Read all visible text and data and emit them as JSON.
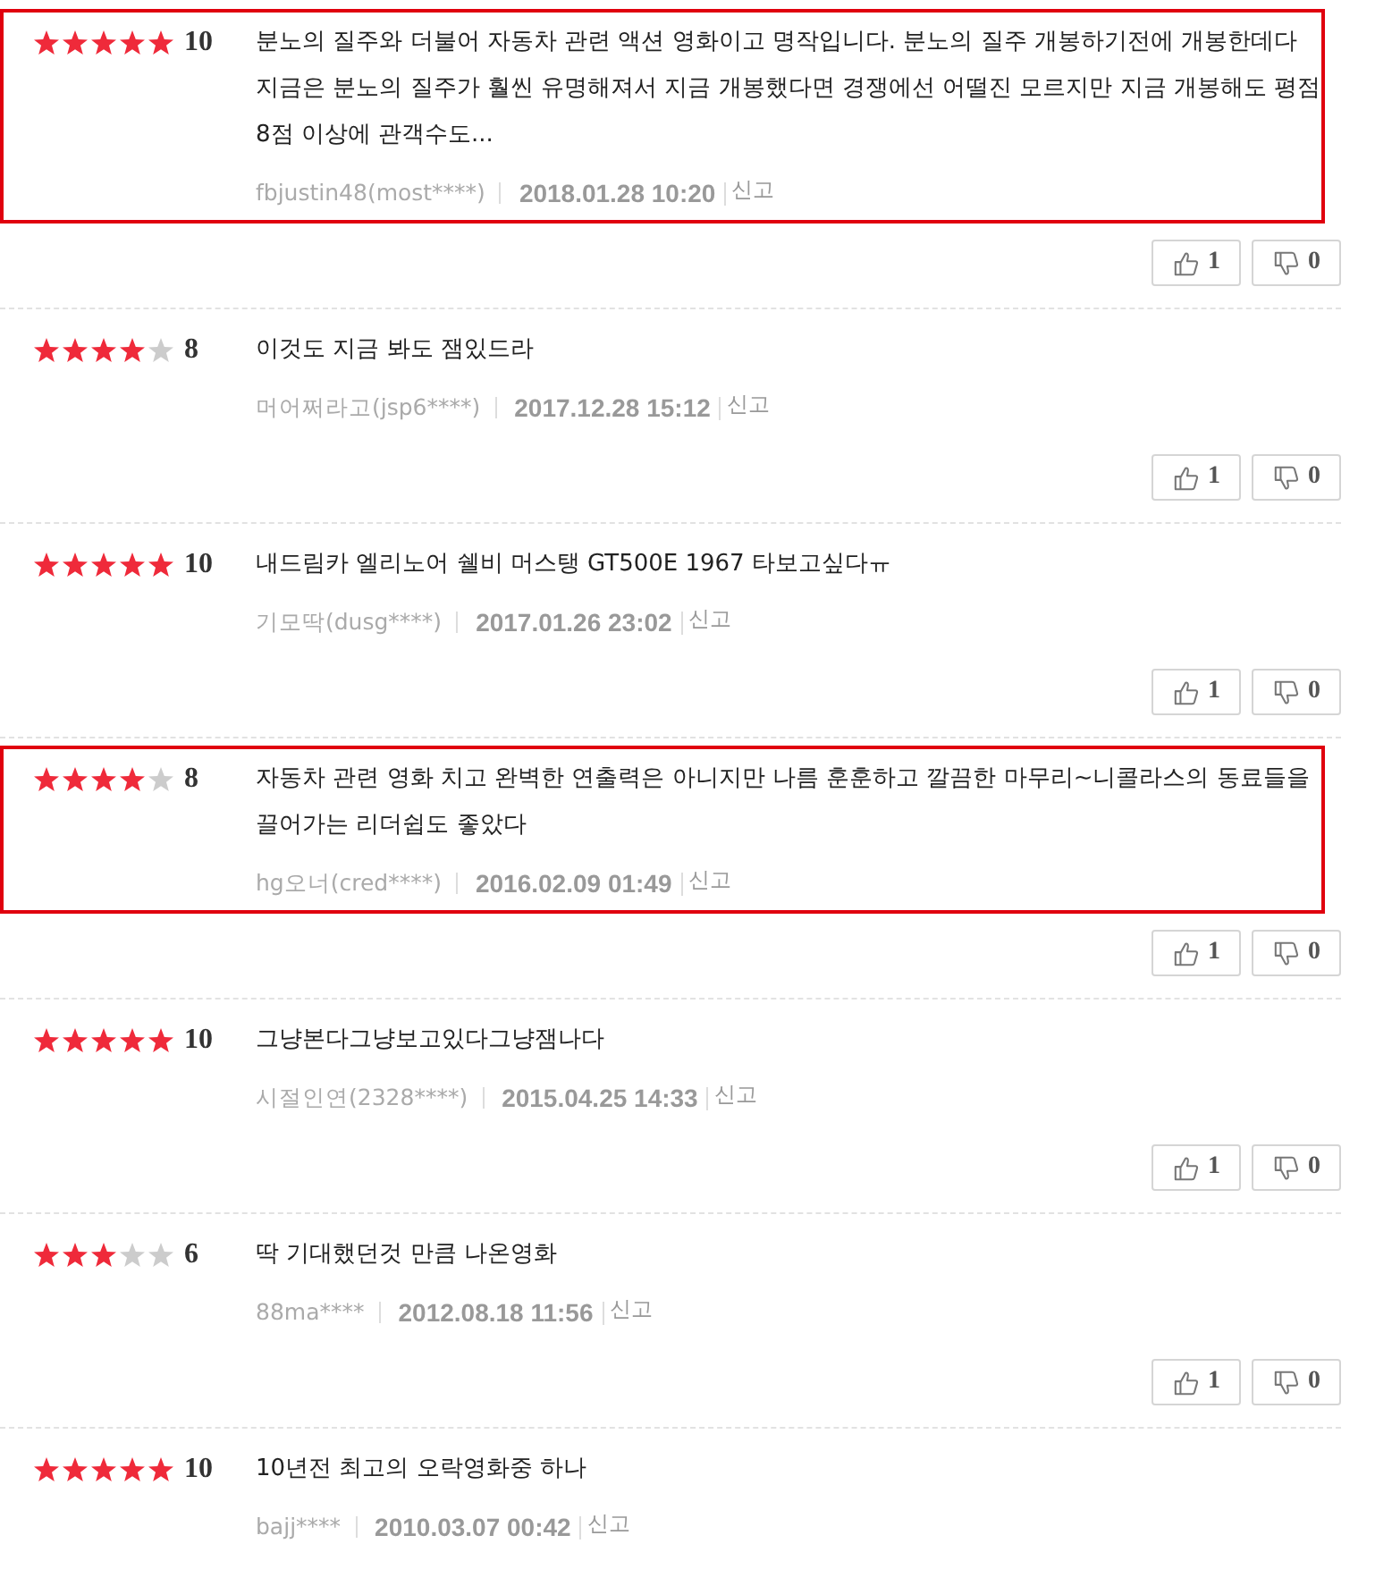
{
  "reviews": [
    {
      "stars": 5,
      "score": "10",
      "text": "분노의 질주와 더불어 자동차 관련 액션 영화이고 명작입니다. 분노의 질주 개봉하기전에 개봉한데다 지금은 분노의 질주가 훨씬 유명해져서 지금 개봉했다면 경쟁에선 어떨진 모르지만 지금 개봉해도 평점 8점 이상에 관객수도...",
      "author": "fbjustin48(most****)",
      "date": "2018.01.28 10:20",
      "report": "신고",
      "highlighted": true,
      "votes": {
        "up": "1",
        "down": "0"
      }
    },
    {
      "stars": 4,
      "score": "8",
      "text": "이것도 지금 봐도 잼있드라",
      "author": "머어쩌라고(jsp6****)",
      "date": "2017.12.28 15:12",
      "report": "신고",
      "highlighted": false,
      "votes": {
        "up": "1",
        "down": "0"
      }
    },
    {
      "stars": 5,
      "score": "10",
      "text": "내드림카 엘리노어 쉘비 머스탱 GT500E 1967 타보고싶다ㅠ",
      "author": "기모딱(dusg****)",
      "date": "2017.01.26 23:02",
      "report": "신고",
      "highlighted": false,
      "votes": {
        "up": "1",
        "down": "0"
      }
    },
    {
      "stars": 4,
      "score": "8",
      "text": "자동차 관련 영화 치고 완벽한 연출력은 아니지만 나름 훈훈하고 깔끔한 마무리~니콜라스의 동료들을 끌어가는 리더쉽도 좋았다",
      "author": "hg오너(cred****)",
      "date": "2016.02.09 01:49",
      "report": "신고",
      "highlighted": true,
      "votes": {
        "up": "1",
        "down": "0"
      }
    },
    {
      "stars": 5,
      "score": "10",
      "text": "그냥본다그냥보고있다그냥잼나다",
      "author": "시절인연(2328****)",
      "date": "2015.04.25 14:33",
      "report": "신고",
      "highlighted": false,
      "votes": {
        "up": "1",
        "down": "0"
      }
    },
    {
      "stars": 3,
      "score": "6",
      "text": "딱 기대했던것 만큼 나온영화",
      "author": "88ma****",
      "date": "2012.08.18 11:56",
      "report": "신고",
      "highlighted": false,
      "votes": {
        "up": "1",
        "down": "0"
      }
    },
    {
      "stars": 5,
      "score": "10",
      "text": "10년전 최고의 오락영화중 하나",
      "author": "bajj****",
      "date": "2010.03.07 00:42",
      "report": "신고",
      "highlighted": false
    }
  ]
}
